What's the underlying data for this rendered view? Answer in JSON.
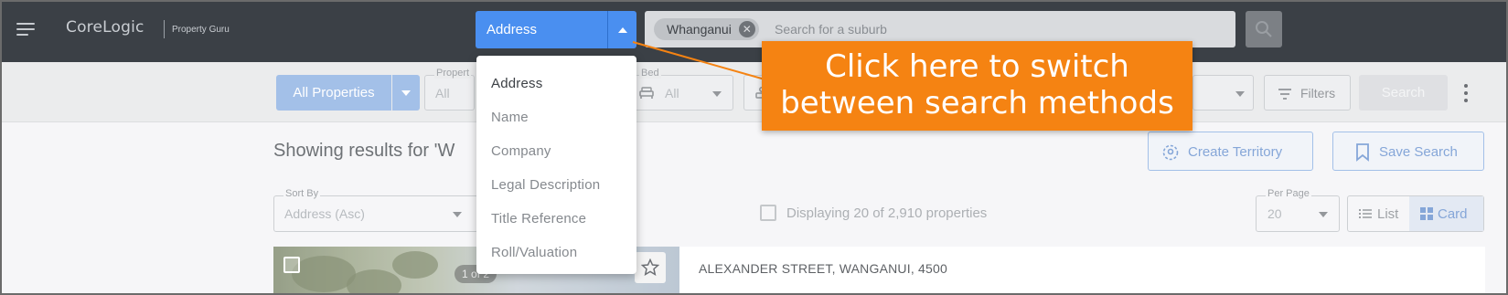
{
  "header": {
    "logo": "CoreLogic",
    "logo_subtitle": "Property Guru",
    "search_type": {
      "selected": "Address"
    },
    "search": {
      "chip": "Whanganui",
      "placeholder": "Search for a suburb"
    }
  },
  "search_type_menu": {
    "items": [
      {
        "label": "Address",
        "active": true
      },
      {
        "label": "Name"
      },
      {
        "label": "Company"
      },
      {
        "label": "Legal Description"
      },
      {
        "label": "Title Reference"
      },
      {
        "label": "Roll/Valuation"
      }
    ]
  },
  "filters": {
    "property_type": "All Properties",
    "property_field": {
      "label": "Propert",
      "value": "All"
    },
    "bed_field": {
      "label": "Bed",
      "value": "All"
    },
    "filters_label": "Filters",
    "search_label": "Search"
  },
  "results": {
    "heading": "Showing results for 'W",
    "create_territory": "Create Territory",
    "save_search": "Save Search",
    "sort": {
      "label": "Sort By",
      "value": "Address (Asc)"
    },
    "count_text": "Displaying 20 of 2,910 properties",
    "per_page": {
      "label": "Per Page",
      "value": "20"
    },
    "view_list": "List",
    "view_card": "Card",
    "first_card": {
      "photo_counter": "1 of 2",
      "address": "ALEXANDER STREET, WANGANUI, 4500"
    }
  },
  "callout": {
    "line1": "Click here to switch",
    "line2": "between search methods",
    "color": "#f58312"
  },
  "colors": {
    "topbar": "#3b4046",
    "accent": "#4a8ff0"
  }
}
